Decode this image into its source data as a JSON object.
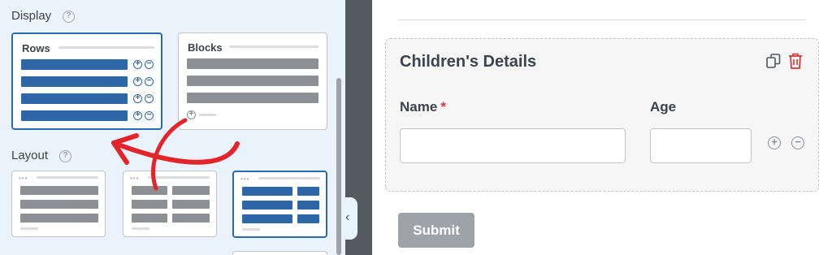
{
  "display": {
    "title": "Display",
    "help_glyph": "?",
    "options": [
      {
        "label": "Rows",
        "selected": true
      },
      {
        "label": "Blocks",
        "selected": false
      }
    ]
  },
  "layout": {
    "title": "Layout",
    "help_glyph": "?",
    "selected_index": 2
  },
  "preview": {
    "repeater_title": "Children's Details",
    "fields": [
      {
        "label": "Name",
        "required": true,
        "required_mark": "*",
        "value": ""
      },
      {
        "label": "Age",
        "required": false,
        "value": ""
      }
    ],
    "submit_label": "Submit"
  },
  "icons": {
    "copy": "copy-icon",
    "trash": "trash-icon",
    "add": "plus-circle-icon",
    "remove": "minus-circle-icon",
    "collapse": "chevron-left-icon"
  },
  "colors": {
    "panel_bg": "#eaf2fb",
    "accent_blue": "#2e67a8",
    "bar_gray": "#8c8f94",
    "trash_red": "#d63638",
    "submit_bg": "#9ea3a8",
    "annotation_arrow": "#e3242b"
  }
}
